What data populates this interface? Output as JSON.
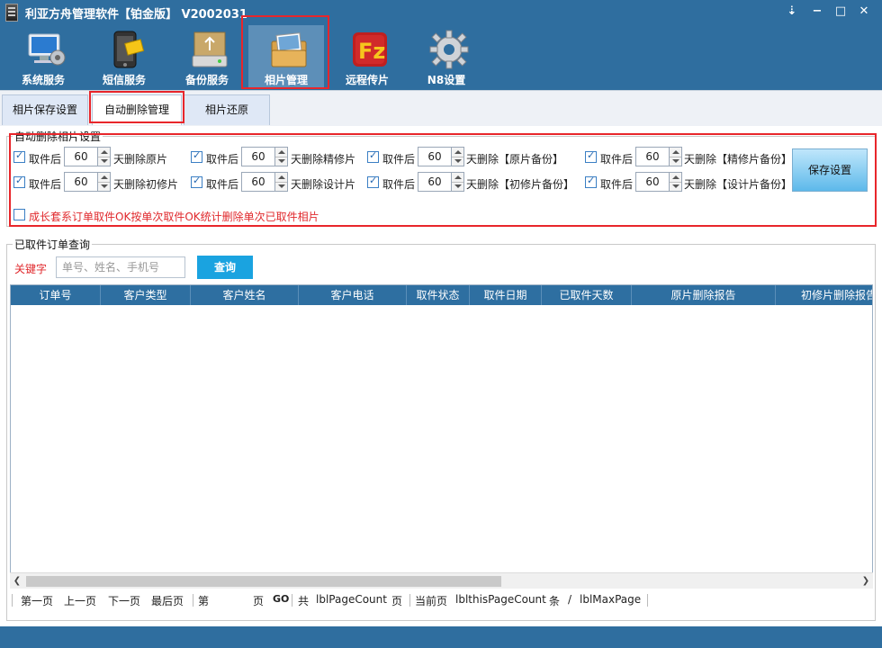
{
  "window": {
    "title": "利亚方舟管理软件【铂金版】 V2002031",
    "min_label": "−",
    "max_label": "□",
    "close_label": "✕",
    "menu_label": "⇣"
  },
  "toolbar": {
    "items": [
      {
        "label": "系统服务",
        "icon": "computer-gear-icon"
      },
      {
        "label": "短信服务",
        "icon": "phone-message-icon"
      },
      {
        "label": "备份服务",
        "icon": "backup-drive-icon"
      },
      {
        "label": "相片管理",
        "icon": "photo-folder-icon"
      },
      {
        "label": "远程传片",
        "icon": "filezilla-icon"
      },
      {
        "label": "N8设置",
        "icon": "gear-icon"
      }
    ],
    "active_index": 3
  },
  "tabs": [
    {
      "label": "相片保存设置"
    },
    {
      "label": "自动删除管理"
    },
    {
      "label": "相片还原"
    }
  ],
  "auto_delete": {
    "group_title": "自动删除相片设置",
    "rows": [
      [
        {
          "checked": true,
          "prefix": "取件后",
          "value": "60",
          "suffix": "天删除原片"
        },
        {
          "checked": true,
          "prefix": "取件后",
          "value": "60",
          "suffix": "天删除精修片"
        },
        {
          "checked": true,
          "prefix": "取件后",
          "value": "60",
          "suffix": "天删除【原片备份】"
        },
        {
          "checked": true,
          "prefix": "取件后",
          "value": "60",
          "suffix": "天删除【精修片备份】"
        }
      ],
      [
        {
          "checked": true,
          "prefix": "取件后",
          "value": "60",
          "suffix": "天删除初修片"
        },
        {
          "checked": true,
          "prefix": "取件后",
          "value": "60",
          "suffix": "天删除设计片"
        },
        {
          "checked": true,
          "prefix": "取件后",
          "value": "60",
          "suffix": "天删除【初修片备份】"
        },
        {
          "checked": true,
          "prefix": "取件后",
          "value": "60",
          "suffix": "天删除【设计片备份】"
        }
      ]
    ],
    "save_label": "保存设置",
    "extra_option": {
      "checked": false,
      "label": "成长套系订单取件OK按单次取件OK统计删除单次已取件相片"
    }
  },
  "query": {
    "group_title": "已取件订单查询",
    "keyword_label": "关键字",
    "placeholder": "单号、姓名、手机号",
    "button_label": "查询"
  },
  "table": {
    "columns": [
      "订单号",
      "客户类型",
      "客户姓名",
      "客户电话",
      "取件状态",
      "取件日期",
      "已取件天数",
      "原片删除报告",
      "初修片删除报告"
    ]
  },
  "pager": {
    "first": "第一页",
    "prev": "上一页",
    "next": "下一页",
    "last": "最后页",
    "page_prefix": "第",
    "page_suffix": "页",
    "go": "GO",
    "total_prefix": "共",
    "page_count": "lblPageCount",
    "total_suffix": "页",
    "current_label": "当前页",
    "this_page_count": "lblthisPageCount",
    "unit": "条",
    "slash": "/",
    "max_page": "lblMaxPage"
  },
  "colors": {
    "accent": "#2f6e9f",
    "highlight": "#e8262b",
    "query_button": "#1aa3e0"
  }
}
